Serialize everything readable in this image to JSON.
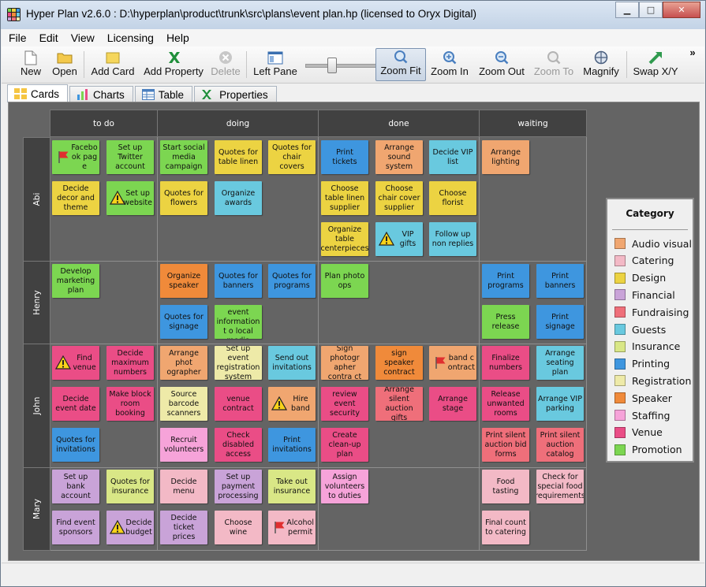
{
  "window": {
    "title": "Hyper Plan v2.6.0 : D:\\hyperplan\\product\\trunk\\src\\plans\\event plan.hp (licensed to Oryx Digital)"
  },
  "menu": [
    "File",
    "Edit",
    "View",
    "Licensing",
    "Help"
  ],
  "toolbar": {
    "new": "New",
    "open": "Open",
    "add_card": "Add Card",
    "add_property": "Add Property",
    "delete": "Delete",
    "left_pane": "Left Pane",
    "zoom_fit": "Zoom Fit",
    "zoom_in": "Zoom In",
    "zoom_out": "Zoom Out",
    "zoom_to": "Zoom To",
    "magnify": "Magnify",
    "swap_xy": "Swap X/Y",
    "more": "»"
  },
  "tabs": [
    "Cards",
    "Charts",
    "Table",
    "Properties"
  ],
  "columns": [
    "to do",
    "doing",
    "done",
    "waiting"
  ],
  "rows": [
    "Abi",
    "Henry",
    "John",
    "Mary"
  ],
  "categories": [
    {
      "name": "Audio visual",
      "color": "#f0a670"
    },
    {
      "name": "Catering",
      "color": "#f3b9c6"
    },
    {
      "name": "Design",
      "color": "#ecd342"
    },
    {
      "name": "Financial",
      "color": "#c9a3d8"
    },
    {
      "name": "Fundraising",
      "color": "#ef6f7a"
    },
    {
      "name": "Guests",
      "color": "#69c9df"
    },
    {
      "name": "Insurance",
      "color": "#d9e786"
    },
    {
      "name": "Printing",
      "color": "#3e96df"
    },
    {
      "name": "Registration",
      "color": "#eeeaa8"
    },
    {
      "name": "Speaker",
      "color": "#f08a3a"
    },
    {
      "name": "Staffing",
      "color": "#f6a3d9"
    },
    {
      "name": "Venue",
      "color": "#ea4d86"
    },
    {
      "name": "Promotion",
      "color": "#7cd651"
    }
  ],
  "legend_title": "Category",
  "cards": [
    {
      "text": "Facebo ok pag e",
      "cat": "Promotion",
      "icon": "flag"
    },
    {
      "text": "Set up Twitter account",
      "cat": "Promotion"
    },
    {
      "text": "Decide decor and theme",
      "cat": "Design"
    },
    {
      "text": "Set up website",
      "cat": "Promotion",
      "icon": "warning"
    },
    {
      "text": "Start social media campaign",
      "cat": "Promotion"
    },
    {
      "text": "Quotes for table linen",
      "cat": "Design"
    },
    {
      "text": "Quotes for chair covers",
      "cat": "Design"
    },
    {
      "text": "Quotes for flowers",
      "cat": "Design"
    },
    {
      "text": "Organize awards",
      "cat": "Guests"
    },
    {
      "text": "Print tickets",
      "cat": "Printing"
    },
    {
      "text": "Arrange sound system",
      "cat": "Audio visual"
    },
    {
      "text": "Decide VIP list",
      "cat": "Guests"
    },
    {
      "text": "Choose table linen supplier",
      "cat": "Design"
    },
    {
      "text": "Choose chair cover supplier",
      "cat": "Design"
    },
    {
      "text": "Choose florist",
      "cat": "Design"
    },
    {
      "text": "Organize table centerpieces",
      "cat": "Design"
    },
    {
      "text": "VIP gifts",
      "cat": "Guests",
      "icon": "warning"
    },
    {
      "text": "Follow up non replies",
      "cat": "Guests"
    },
    {
      "text": "Arrange lighting",
      "cat": "Audio visual"
    },
    {
      "text": "Develop marketing plan",
      "cat": "Promotion"
    },
    {
      "text": "Organize speaker",
      "cat": "Speaker"
    },
    {
      "text": "Quotes for banners",
      "cat": "Printing"
    },
    {
      "text": "Quotes for programs",
      "cat": "Printing"
    },
    {
      "text": "Quotes for signage",
      "cat": "Printing"
    },
    {
      "text": "Submit event information t o local media",
      "cat": "Promotion"
    },
    {
      "text": "Plan photo ops",
      "cat": "Promotion"
    },
    {
      "text": "Print programs",
      "cat": "Printing"
    },
    {
      "text": "Print banners",
      "cat": "Printing"
    },
    {
      "text": "Press release",
      "cat": "Promotion"
    },
    {
      "text": "Print signage",
      "cat": "Printing"
    },
    {
      "text": "Find venue",
      "cat": "Venue",
      "icon": "warning"
    },
    {
      "text": "Decide maximum numbers",
      "cat": "Venue"
    },
    {
      "text": "Decide event date",
      "cat": "Venue"
    },
    {
      "text": "Make block room booking",
      "cat": "Venue"
    },
    {
      "text": "Quotes for invitations",
      "cat": "Printing"
    },
    {
      "text": "Arrange phot ographer",
      "cat": "Audio visual"
    },
    {
      "text": "Set up event registration system",
      "cat": "Registration"
    },
    {
      "text": "Send out invitations",
      "cat": "Guests"
    },
    {
      "text": "Source barcode scanners",
      "cat": "Registration"
    },
    {
      "text": "venue contract",
      "cat": "Venue"
    },
    {
      "text": "Hire band",
      "cat": "Audio visual",
      "icon": "warning"
    },
    {
      "text": "Recruit volunteers",
      "cat": "Staffing"
    },
    {
      "text": "Check disabled access",
      "cat": "Venue"
    },
    {
      "text": "Print invitations",
      "cat": "Printing"
    },
    {
      "text": "Sign photogr apher contra ct",
      "cat": "Audio visual"
    },
    {
      "text": "sign speaker contract",
      "cat": "Speaker"
    },
    {
      "text": "band c ontract",
      "cat": "Audio visual",
      "icon": "flag"
    },
    {
      "text": "review event security",
      "cat": "Venue"
    },
    {
      "text": "Arrange silent auction gifts",
      "cat": "Fundraising"
    },
    {
      "text": "Arrange stage",
      "cat": "Venue"
    },
    {
      "text": "Create clean-up plan",
      "cat": "Venue"
    },
    {
      "text": "Finalize numbers",
      "cat": "Venue"
    },
    {
      "text": "Arrange seating plan",
      "cat": "Guests"
    },
    {
      "text": "Release unwanted rooms",
      "cat": "Venue"
    },
    {
      "text": "Arrange VIP parking",
      "cat": "Guests"
    },
    {
      "text": "Print silent auction bid forms",
      "cat": "Fundraising"
    },
    {
      "text": "Print silent auction catalog",
      "cat": "Fundraising"
    },
    {
      "text": "Set up bank account",
      "cat": "Financial"
    },
    {
      "text": "Quotes for insurance",
      "cat": "Insurance"
    },
    {
      "text": "Find event sponsors",
      "cat": "Financial"
    },
    {
      "text": "Decide budget",
      "cat": "Financial",
      "icon": "warning"
    },
    {
      "text": "Decide menu",
      "cat": "Catering"
    },
    {
      "text": "Set up payment processing",
      "cat": "Financial"
    },
    {
      "text": "Take out insurance",
      "cat": "Insurance"
    },
    {
      "text": "Decide ticket prices",
      "cat": "Financial"
    },
    {
      "text": "Choose wine",
      "cat": "Catering"
    },
    {
      "text": "Alcohol permit",
      "cat": "Catering",
      "icon": "flag"
    },
    {
      "text": "Assign volunteers to duties",
      "cat": "Staffing"
    },
    {
      "text": "Food tasting",
      "cat": "Catering"
    },
    {
      "text": "Check for special food requirements",
      "cat": "Catering"
    },
    {
      "text": "Final count to catering",
      "cat": "Catering"
    }
  ]
}
